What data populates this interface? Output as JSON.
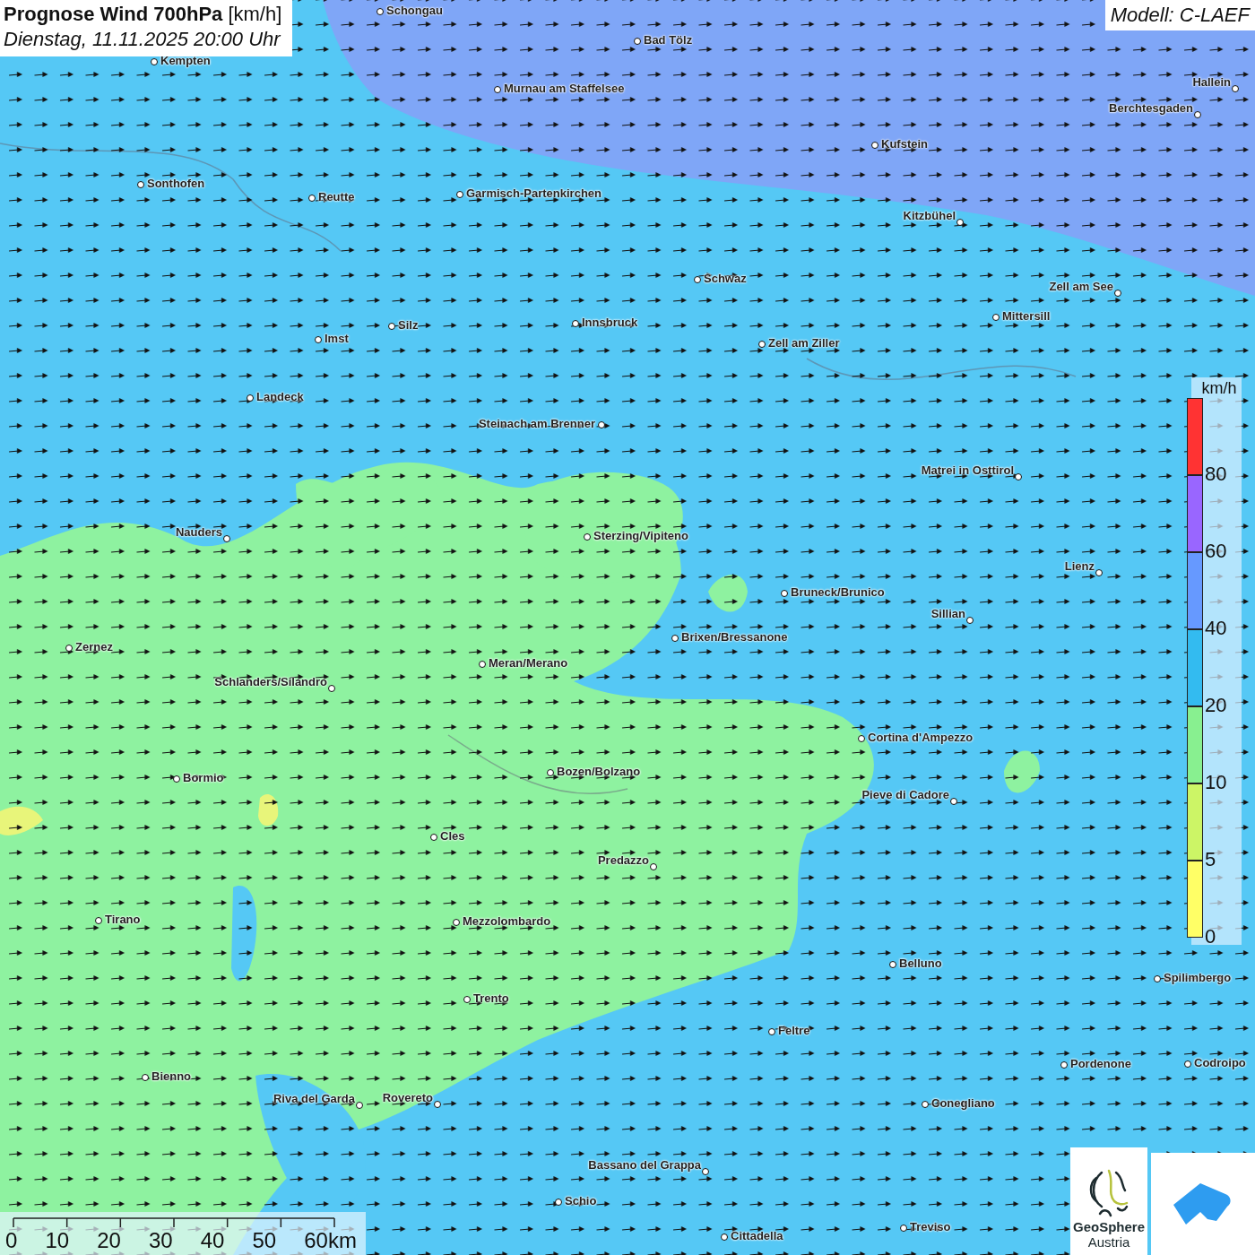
{
  "title": {
    "heading": "**Prognose Wind 700hPa** [km/h]",
    "subtitle": "Dienstag, 11.11.2025 20:00 Uhr"
  },
  "model": "Modell: C-LAEF",
  "cities": [
    "Schongau",
    "Bad Tölz",
    "Kempten",
    "Murnau am Staffelsee",
    "Hallein",
    "Berchtesgaden",
    "Kufstein",
    "Sonthofen",
    "Reutte",
    "Garmisch-Partenkirchen",
    "Kitzbühel",
    "Schwaz",
    "Zell am See",
    "Mittersill",
    "Innsbruck",
    "Silz",
    "Imst",
    "Zell am Ziller",
    "Landeck",
    "Steinach am Brenner",
    "Matrei in Osttirol",
    "Nauders",
    "Sterzing/Vipiteno",
    "Lienz",
    "Bruneck/Brunico",
    "Sillian",
    "Brixen/Bressanone",
    "Zernez",
    "Meran/Merano",
    "Schlanders/Silandro",
    "Cortina d'Ampezzo",
    "Bozen/Bolzano",
    "Bormio",
    "Pieve di Cadore",
    "Cles",
    "Predazzo",
    "Tirano",
    "Mezzolombardo",
    "Belluno",
    "Spilimbergo",
    "Trento",
    "Feltre",
    "Pordenone",
    "Codroipo",
    "Bienno",
    "Riva del Garda",
    "Rovereto",
    "Conegliano",
    "Bassano del Grappa",
    "Schio",
    "Treviso",
    "Cittadella"
  ],
  "legend": {
    "unit": "km/h",
    "bands": [
      {
        "color": "#ff3333",
        "label": "80"
      },
      {
        "color": "#9966ff",
        "label": "60"
      },
      {
        "color": "#6699ff",
        "label": "40"
      },
      {
        "color": "#33bbf0",
        "label": "20"
      },
      {
        "color": "#88f090",
        "label": "10"
      },
      {
        "color": "#ccf566",
        "label": "5"
      },
      {
        "color": "#ffff66",
        "label": "0"
      }
    ]
  },
  "scale": [
    "0",
    "10",
    "20",
    "30",
    "40",
    "50",
    "60km"
  ],
  "logo": {
    "name": "GeoSphere",
    "sub": "Austria"
  }
}
